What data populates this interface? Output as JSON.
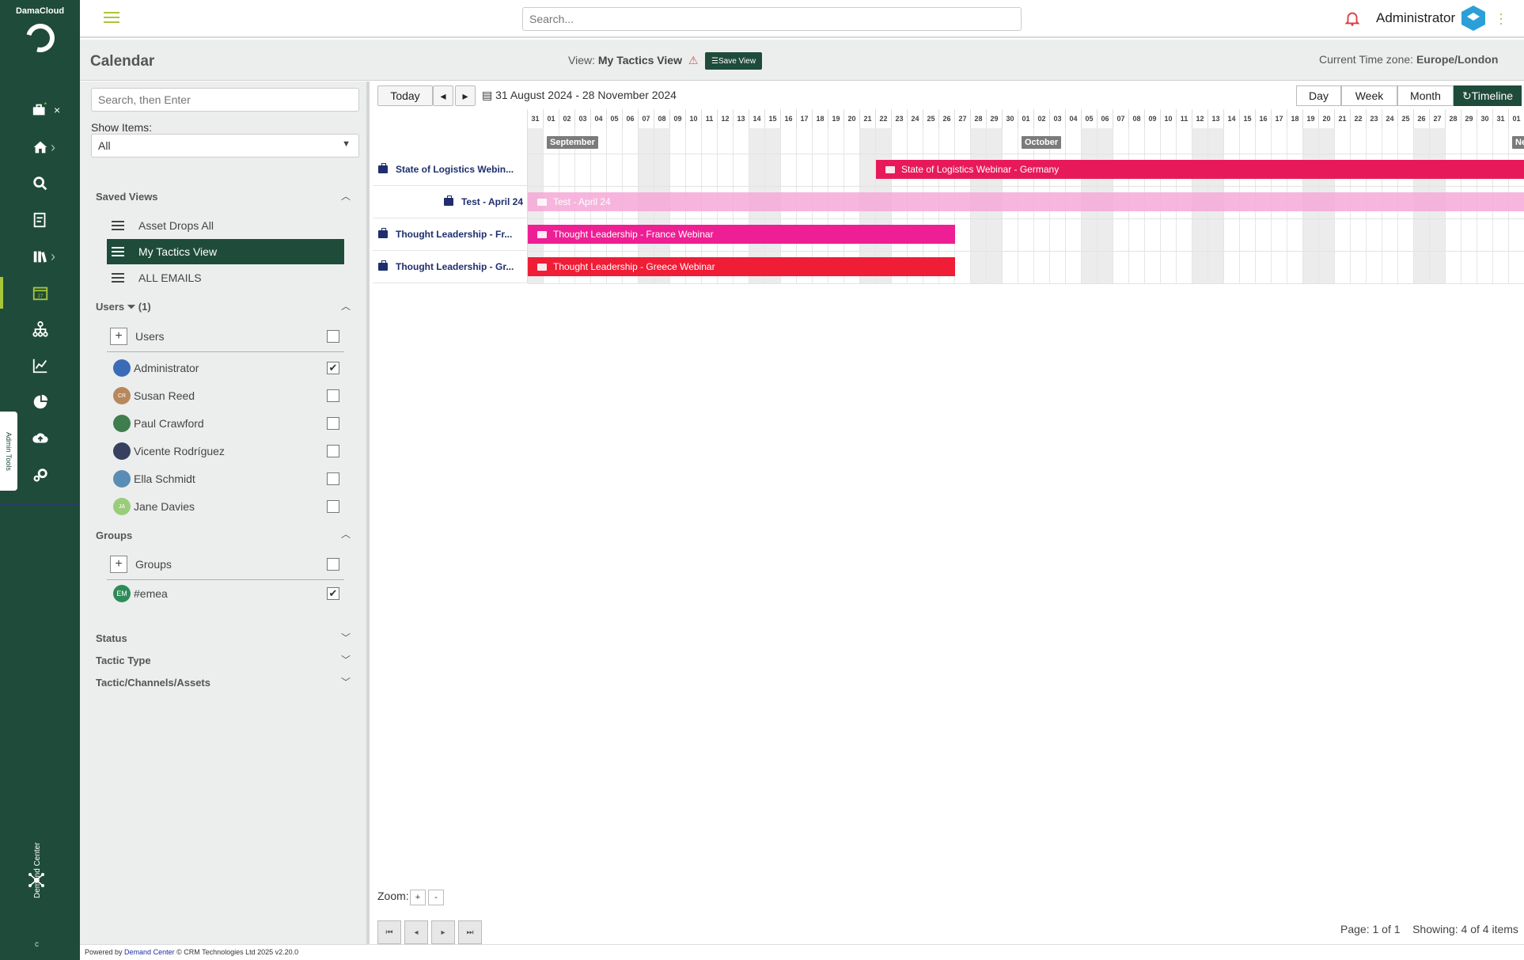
{
  "brand": {
    "name": "DamaCloud",
    "footer_name": "Demand Center"
  },
  "topbar": {
    "search_placeholder": "Search...",
    "user_name": "Administrator",
    "notification_icon": "bell-icon"
  },
  "header": {
    "title": "Calendar",
    "view_prefix": "View:",
    "view_name": "My Tactics View",
    "save_view_label": "Save View",
    "timezone_label": "Current Time zone:",
    "timezone_value": "Europe/London"
  },
  "sidebar": {
    "search_placeholder": "Search, then Enter",
    "show_items_label": "Show Items:",
    "show_items_value": "All",
    "saved_views_title": "Saved Views",
    "saved_views": [
      {
        "label": "Asset Drops All",
        "active": false
      },
      {
        "label": "My Tactics View",
        "active": true
      },
      {
        "label": "ALL EMAILS",
        "active": false
      }
    ],
    "users_title": "Users",
    "users_filter_count": "(1)",
    "users_add_label": "Users",
    "users": [
      {
        "name": "Administrator",
        "checked": true,
        "initials": "",
        "color": "#3b6bb8"
      },
      {
        "name": "Susan Reed",
        "checked": false,
        "initials": "CR",
        "color": "#b7885e"
      },
      {
        "name": "Paul Crawford",
        "checked": false,
        "initials": "",
        "color": "#3f7d4e"
      },
      {
        "name": "Vicente Rodríguez",
        "checked": false,
        "initials": "",
        "color": "#384060"
      },
      {
        "name": "Ella Schmidt",
        "checked": false,
        "initials": "",
        "color": "#5a8db5"
      },
      {
        "name": "Jane Davies",
        "checked": false,
        "initials": "JA",
        "color": "#9acd7a"
      }
    ],
    "groups_title": "Groups",
    "groups_add_label": "Groups",
    "groups": [
      {
        "name": "#emea",
        "checked": true,
        "initials": "EM",
        "color": "#2e8b57"
      }
    ],
    "collapsed_sections": [
      "Status",
      "Tactic Type",
      "Tactic/Channels/Assets"
    ]
  },
  "toolbar": {
    "today_label": "Today",
    "date_range": "31 August 2024 - 28 November 2024",
    "views": [
      {
        "label": "Day",
        "active": false
      },
      {
        "label": "Week",
        "active": false
      },
      {
        "label": "Month",
        "active": false
      },
      {
        "label": "Timeline",
        "active": true
      }
    ]
  },
  "timeline": {
    "days": [
      "31",
      "01",
      "02",
      "03",
      "04",
      "05",
      "06",
      "07",
      "08",
      "09",
      "10",
      "11",
      "12",
      "13",
      "14",
      "15",
      "16",
      "17",
      "18",
      "19",
      "20",
      "21",
      "22",
      "23",
      "24",
      "25",
      "26",
      "27",
      "28",
      "29",
      "30",
      "01",
      "02",
      "03",
      "04",
      "05",
      "06",
      "07",
      "08",
      "09",
      "10",
      "11",
      "12",
      "13",
      "14",
      "15",
      "16",
      "17",
      "18",
      "19",
      "20",
      "21",
      "22",
      "23",
      "24",
      "25",
      "26",
      "27",
      "28",
      "29",
      "30",
      "31",
      "01"
    ],
    "weekend_indices": [
      0,
      7,
      8,
      14,
      15,
      21,
      22,
      28,
      29,
      35,
      36,
      42,
      43,
      49,
      50,
      56,
      57,
      63
    ],
    "months": [
      {
        "label": "September",
        "start_day_index": 1
      },
      {
        "label": "October",
        "start_day_index": 31
      },
      {
        "label": "Ne",
        "start_day_index": 62
      }
    ],
    "tasks": [
      {
        "label": "State of Logistics Webin...",
        "bar_label": "State of Logistics Webinar - Germany",
        "start_index": 22,
        "end_index": 63,
        "color": "#e8195a"
      },
      {
        "label": "Test - April 24",
        "bar_label": "Test - April 24",
        "start_index": 0,
        "end_index": 63,
        "color": "#f6a9d8"
      },
      {
        "label": "Thought Leadership - Fr...",
        "bar_label": "Thought Leadership - France Webinar",
        "start_index": 0,
        "end_index": 27,
        "color": "#ee1f94"
      },
      {
        "label": "Thought Leadership - Gr...",
        "bar_label": "Thought Leadership - Greece Webinar",
        "start_index": 0,
        "end_index": 27,
        "color": "#f01d37"
      }
    ]
  },
  "footer_controls": {
    "zoom_label": "Zoom:",
    "zoom_in": "+",
    "zoom_out": "-",
    "page_info": "Page: 1 of 1",
    "showing_info": "Showing: 4 of 4 items"
  },
  "footer": {
    "powered_by": "Powered by",
    "link": "Demand Center",
    "copyright": "© CRM Technologies Ltd 2025 v2.20.0"
  },
  "rail": {
    "admin_tools_label": "Admin Tools",
    "demand_center_label": "Demand Center",
    "bottom_glyph": "c"
  }
}
